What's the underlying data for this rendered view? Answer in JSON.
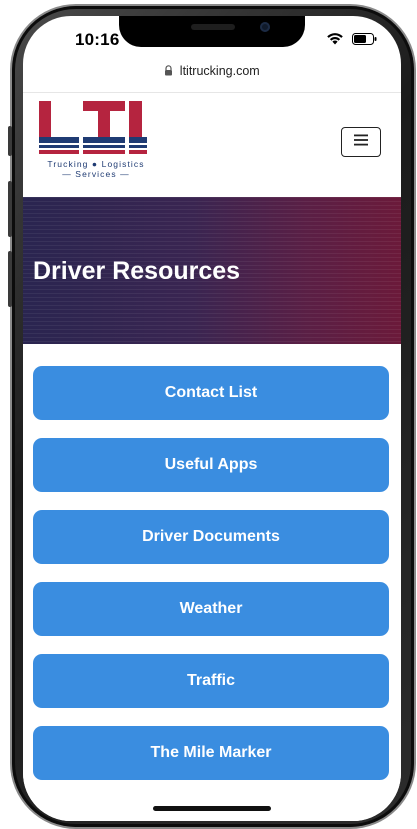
{
  "status_bar": {
    "time": "10:16",
    "url": "ltitrucking.com"
  },
  "logo": {
    "letters": "LTI",
    "tagline_line1": "Trucking ● Logistics",
    "tagline_line2": "— Services —"
  },
  "hero": {
    "title": "Driver Resources"
  },
  "resources": [
    {
      "label": "Contact List"
    },
    {
      "label": "Useful Apps"
    },
    {
      "label": "Driver Documents"
    },
    {
      "label": "Weather"
    },
    {
      "label": "Traffic"
    },
    {
      "label": "The Mile Marker"
    }
  ],
  "colors": {
    "button_blue": "#3a8de0",
    "logo_red": "#b5243f",
    "logo_navy": "#1f3b73"
  },
  "icons": {
    "lock": "lock-icon",
    "wifi": "wifi-icon",
    "battery": "battery-icon",
    "menu": "hamburger-menu-icon"
  }
}
